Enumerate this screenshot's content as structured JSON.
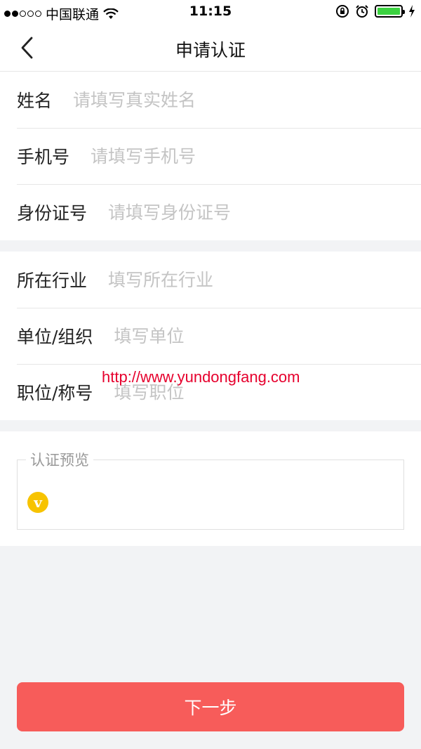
{
  "status_bar": {
    "carrier": "中国联通",
    "time": "11:15",
    "signal_icon": "signal-dots",
    "wifi_icon": "wifi-icon",
    "lock_icon": "rotation-lock-icon",
    "alarm_icon": "alarm-icon",
    "battery_icon": "battery-icon",
    "battery_color": "#3bd240"
  },
  "nav": {
    "back_icon": "chevron-left-icon",
    "title": "申请认证"
  },
  "form": {
    "basic": [
      {
        "label": "姓名",
        "placeholder": "请填写真实姓名",
        "value": ""
      },
      {
        "label": "手机号",
        "placeholder": "请填写手机号",
        "value": ""
      },
      {
        "label": "身份证号",
        "placeholder": "请填写身份证号",
        "value": ""
      }
    ],
    "work": [
      {
        "label": "所在行业",
        "placeholder": "填写所在行业",
        "value": ""
      },
      {
        "label": "单位/组织",
        "placeholder": "填写单位",
        "value": ""
      },
      {
        "label": "职位/称号",
        "placeholder": "填写职位",
        "value": ""
      }
    ]
  },
  "preview": {
    "legend": "认证预览",
    "badge": "v",
    "badge_color": "#f7c300"
  },
  "watermark": "http://www.yundongfang.com",
  "next_button": {
    "label": "下一步",
    "color": "#f75c5a"
  }
}
